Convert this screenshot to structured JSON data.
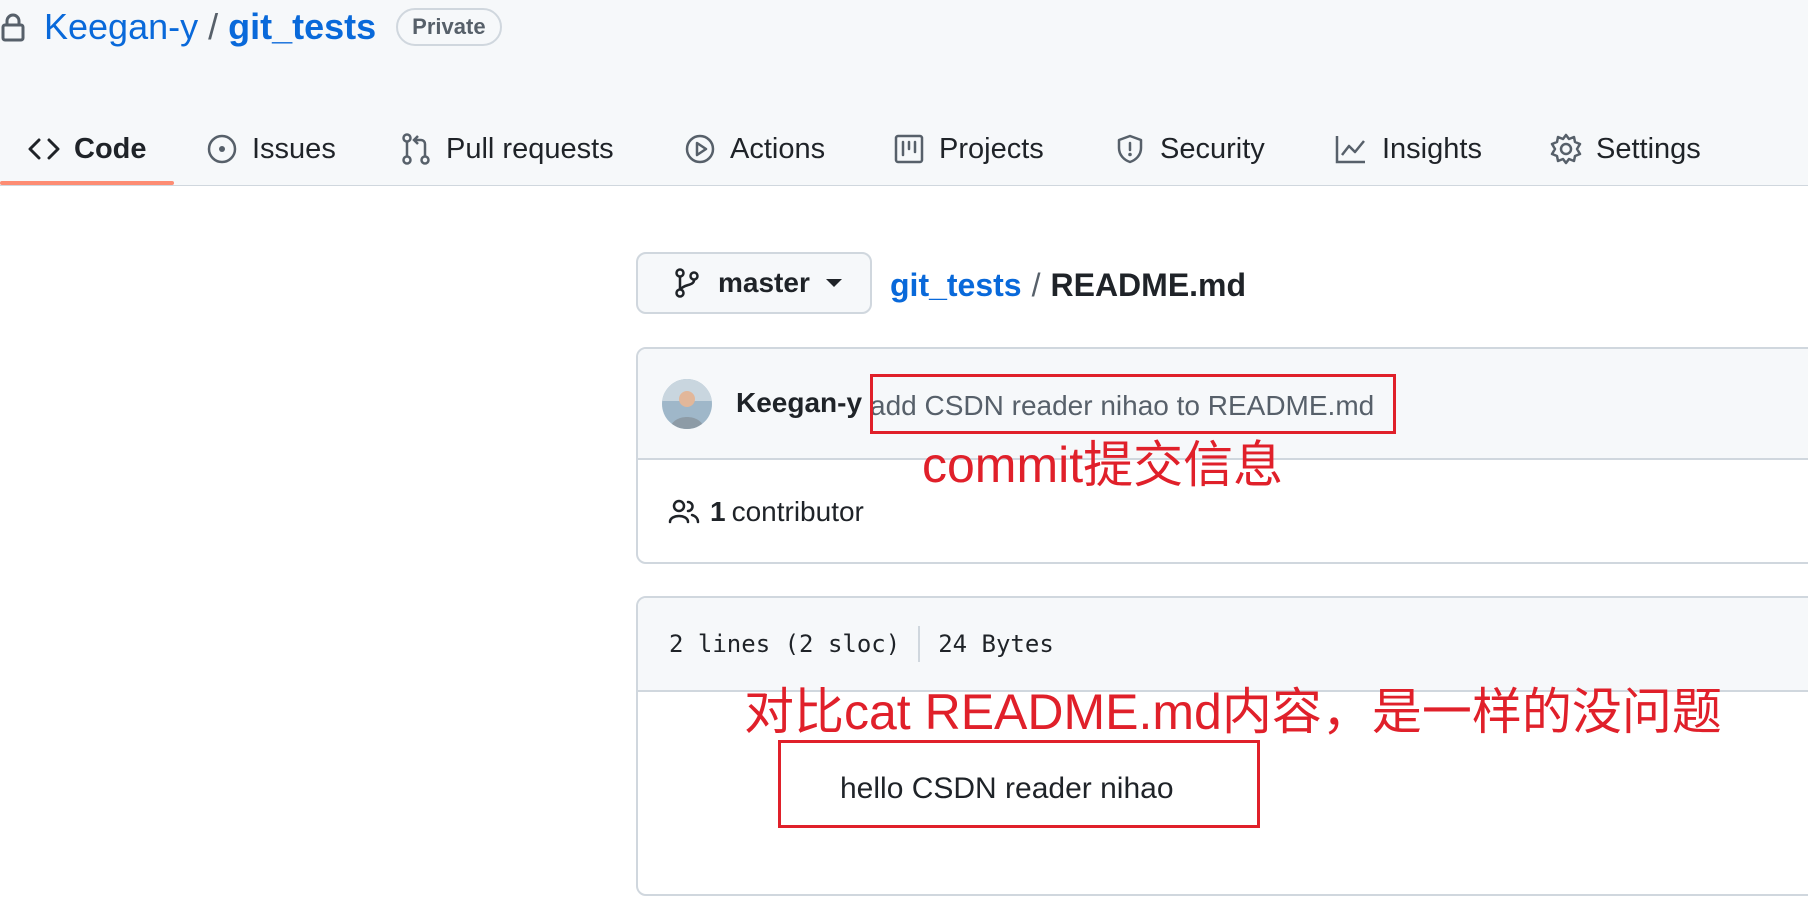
{
  "repo": {
    "owner": "Keegan-y",
    "separator": "/",
    "name": "git_tests",
    "visibility": "Private"
  },
  "tabs": [
    {
      "label": "Code",
      "icon": "code-icon",
      "active": true
    },
    {
      "label": "Issues",
      "icon": "issue-icon"
    },
    {
      "label": "Pull requests",
      "icon": "pull-request-icon"
    },
    {
      "label": "Actions",
      "icon": "play-icon"
    },
    {
      "label": "Projects",
      "icon": "project-icon"
    },
    {
      "label": "Security",
      "icon": "shield-icon"
    },
    {
      "label": "Insights",
      "icon": "graph-icon"
    },
    {
      "label": "Settings",
      "icon": "gear-icon"
    }
  ],
  "branch": {
    "name": "master"
  },
  "breadcrumb": {
    "repo": "git_tests",
    "separator": "/",
    "file": "README.md"
  },
  "commit": {
    "author": "Keegan-y",
    "message": "add CSDN reader nihao to README.md"
  },
  "contributors": {
    "count": "1",
    "label": "contributor"
  },
  "file_info": {
    "lines": "2 lines (2 sloc)",
    "size": "24 Bytes"
  },
  "file_content": "hello CSDN reader nihao",
  "annotations": {
    "commit_note": "commit提交信息",
    "compare_note": "对比cat README.md内容，是一样的没问题",
    "color": "#e0202a"
  },
  "colors": {
    "link": "#0969da",
    "active_tab_underline": "#fd8c73",
    "border": "#d0d7de"
  }
}
